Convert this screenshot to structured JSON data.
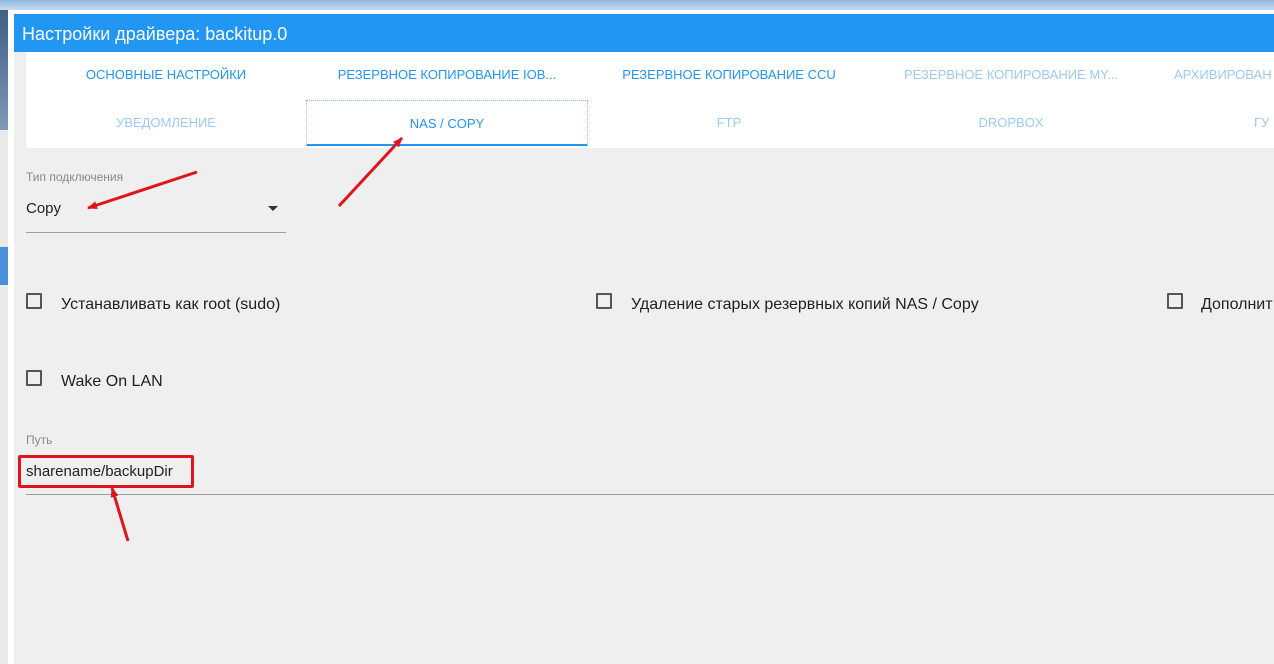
{
  "dialog": {
    "title": "Настройки драйвера: backitup.0"
  },
  "tabs_row1": [
    {
      "label": "ОСНОВНЫЕ НАСТРОЙКИ"
    },
    {
      "label": "РЕЗЕРВНОЕ КОПИРОВАНИЕ IOB..."
    },
    {
      "label": "РЕЗЕРВНОЕ КОПИРОВАНИЕ CCU"
    },
    {
      "label": "РЕЗЕРВНОЕ КОПИРОВАНИЕ MY..."
    },
    {
      "label": "АРХИВИРОВАН"
    }
  ],
  "tabs_row2": [
    {
      "label": "УВЕДОМЛЕНИЕ"
    },
    {
      "label": "NAS / COPY"
    },
    {
      "label": "FTP"
    },
    {
      "label": "DROPBOX"
    },
    {
      "label": "ГУ"
    }
  ],
  "connection_type": {
    "label": "Тип подключения",
    "value": "Copy"
  },
  "checkboxes": {
    "sudo": "Устанавливать как root (sudo)",
    "delete_old": "Удаление старых резервных копий NAS / Copy",
    "extra": "Дополнит",
    "wol": "Wake On LAN"
  },
  "path": {
    "label": "Путь",
    "value": "sharename/backupDir"
  },
  "colors": {
    "accent": "#2196f3",
    "annotation": "#e0141c"
  }
}
